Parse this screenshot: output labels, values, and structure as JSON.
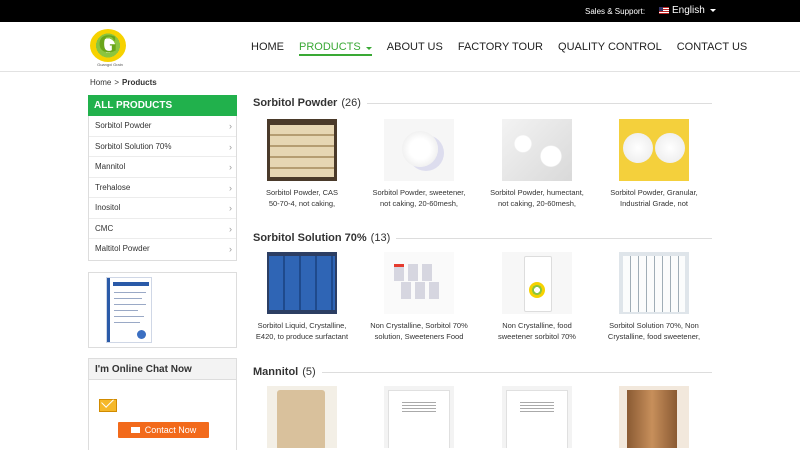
{
  "topbar": {
    "sales_label": "Sales & Support:",
    "language": "English"
  },
  "logo": {
    "tagline": "Guangxi Grain"
  },
  "nav": [
    {
      "label": "HOME",
      "active": false
    },
    {
      "label": "PRODUCTS",
      "active": true
    },
    {
      "label": "ABOUT US",
      "active": false
    },
    {
      "label": "FACTORY TOUR",
      "active": false
    },
    {
      "label": "QUALITY CONTROL",
      "active": false
    },
    {
      "label": "CONTACT US",
      "active": false
    }
  ],
  "breadcrumb": {
    "home": "Home",
    "current": "Products"
  },
  "sidebar": {
    "title": "ALL PRODUCTS",
    "items": [
      "Sorbitol Powder",
      "Sorbitol Solution 70%",
      "Mannitol",
      "Trehalose",
      "Inositol",
      "CMC",
      "Maltitol Powder"
    ],
    "chat_title": "I'm Online Chat Now",
    "contact_label": "Contact Now"
  },
  "sections": [
    {
      "title": "Sorbitol Powder",
      "count": "(26)",
      "products": [
        {
          "line1": "Sorbitol Powder, CAS",
          "line2": "50-70-4, not caking,"
        },
        {
          "line1": "Sorbitol Powder, sweetener,",
          "line2": "not caking, 20-60mesh,"
        },
        {
          "line1": "Sorbitol Powder, humectant,",
          "line2": "not caking, 20-60mesh,"
        },
        {
          "line1": "Sorbitol Powder, Granular,",
          "line2": "Industrial Grade, not"
        }
      ]
    },
    {
      "title": "Sorbitol Solution 70%",
      "count": "(13)",
      "products": [
        {
          "line1": "Sorbitol Liquid, Crystalline,",
          "line2": "E420, to produce surfactant"
        },
        {
          "line1": "Non Crystalline, Sorbitol 70%",
          "line2": "solution, Sweeteners Food"
        },
        {
          "line1": "Non Crystalline, food",
          "line2": "sweetener sorbitol 70%"
        },
        {
          "line1": "Sorbitol Solution 70%, Non",
          "line2": "Crystalline, food sweetener,"
        }
      ]
    },
    {
      "title": "Mannitol",
      "count": "(5)",
      "products": []
    }
  ]
}
